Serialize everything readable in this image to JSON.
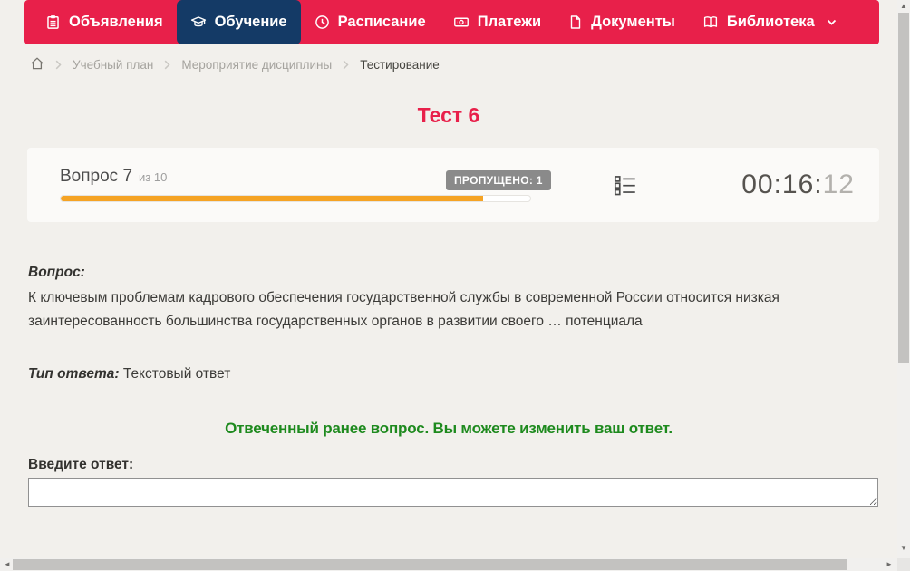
{
  "nav": {
    "items": [
      {
        "label": "Объявления",
        "icon": "clipboard-icon",
        "active": false
      },
      {
        "label": "Обучение",
        "icon": "graduation-cap-icon",
        "active": true
      },
      {
        "label": "Расписание",
        "icon": "clock-icon",
        "active": false
      },
      {
        "label": "Платежи",
        "icon": "banknote-icon",
        "active": false
      },
      {
        "label": "Документы",
        "icon": "document-icon",
        "active": false
      },
      {
        "label": "Библиотека",
        "icon": "open-book-icon",
        "active": false,
        "has_dropdown": true
      }
    ]
  },
  "breadcrumb": {
    "home_icon": "home-icon",
    "items": [
      "Учебный план",
      "Мероприятие дисциплины",
      "Тестирование"
    ]
  },
  "page": {
    "title": "Тест 6"
  },
  "quiz": {
    "question_number_label": "Вопрос 7",
    "question_total_label": "из 10",
    "skipped_badge": "ПРОПУЩЕНО: 1",
    "progress_percent": 90,
    "progress_width": "90%",
    "question_list_icon": "question-list-icon",
    "timer_main": "00:16:",
    "timer_seconds": "12",
    "question_heading": "Вопрос:",
    "question_text": "К ключевым проблемам кадрового обеспечения государственной службы в современной России относится низкая заинтересованность большинства государственных органов в развитии своего … потенциала",
    "answer_type_label": "Тип ответа:",
    "answer_type_value": "Текстовый ответ",
    "answered_note": "Отвеченный ранее вопрос. Вы можете изменить ваш ответ.",
    "input_label": "Введите ответ:",
    "input_value": ""
  },
  "colors": {
    "nav_background": "#e8204a",
    "nav_active_background": "#143a66",
    "page_background": "#f2f0ec",
    "title_color": "#e8204a",
    "progress_fill": "#f5a324",
    "skipped_badge_background": "#8a8a8a",
    "answered_note_color": "#1e8a1e"
  }
}
